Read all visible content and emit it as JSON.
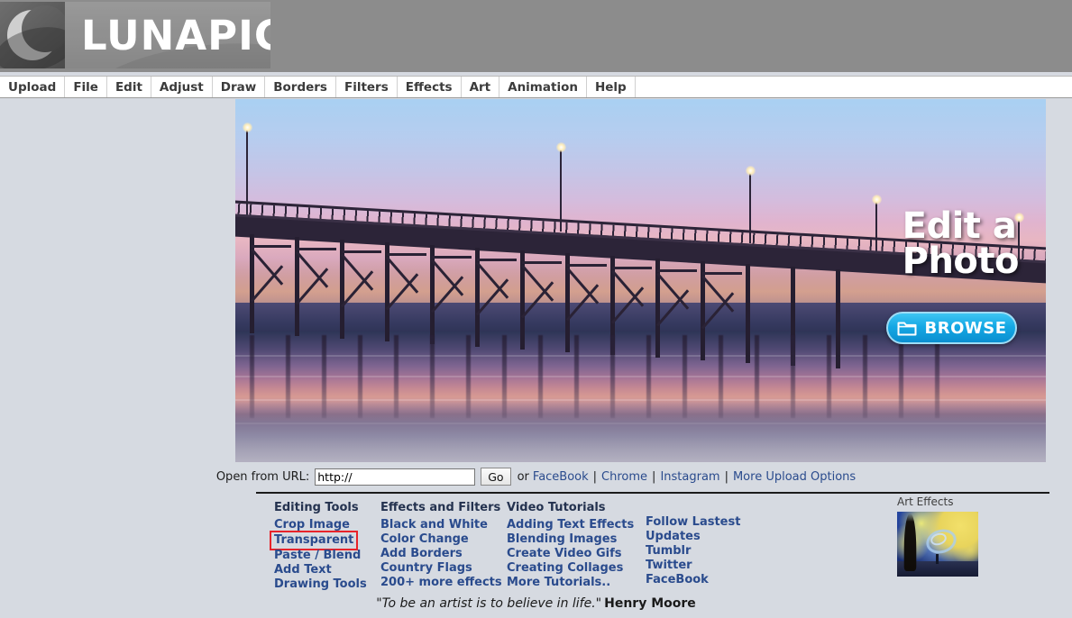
{
  "header": {
    "logo_wordmark": "LUNAPIC",
    "logo_icon": "crescent-moon-icon",
    "bg_color": "#8c8c8c"
  },
  "menubar": {
    "items": [
      {
        "label": "Upload"
      },
      {
        "label": "File"
      },
      {
        "label": "Edit"
      },
      {
        "label": "Adjust"
      },
      {
        "label": "Draw"
      },
      {
        "label": "Borders"
      },
      {
        "label": "Filters"
      },
      {
        "label": "Effects"
      },
      {
        "label": "Art"
      },
      {
        "label": "Animation"
      },
      {
        "label": "Help"
      }
    ]
  },
  "hero": {
    "title_line1": "Edit a",
    "title_line2": "Photo",
    "browse_label": "BROWSE",
    "browse_icon": "folder-icon",
    "image_description": "pier-at-sunset-photo"
  },
  "url_row": {
    "label": "Open from URL:",
    "input_value": "http://",
    "go_label": "Go",
    "or_text": "or",
    "links": [
      {
        "label": "FaceBook"
      },
      {
        "label": "Chrome"
      },
      {
        "label": "Instagram"
      },
      {
        "label": "More Upload Options"
      }
    ],
    "separator": "|"
  },
  "columns": [
    {
      "heading": "Editing Tools",
      "links": [
        {
          "label": "Crop Image",
          "highlighted": false
        },
        {
          "label": "Transparent",
          "highlighted": true
        },
        {
          "label": "Paste / Blend",
          "highlighted": false
        },
        {
          "label": "Add Text",
          "highlighted": false
        },
        {
          "label": "Drawing Tools",
          "highlighted": false
        }
      ]
    },
    {
      "heading": "Effects and Filters",
      "links": [
        {
          "label": "Black and White",
          "highlighted": false
        },
        {
          "label": "Color Change",
          "highlighted": false
        },
        {
          "label": "Add Borders",
          "highlighted": false
        },
        {
          "label": "Country Flags",
          "highlighted": false
        },
        {
          "label": "200+ more effects",
          "highlighted": false
        }
      ]
    },
    {
      "heading": "Video Tutorials",
      "links": [
        {
          "label": "Adding Text Effects",
          "highlighted": false
        },
        {
          "label": "Blending Images",
          "highlighted": false
        },
        {
          "label": "Create Video Gifs",
          "highlighted": false
        },
        {
          "label": "Creating Collages",
          "highlighted": false
        },
        {
          "label": "More Tutorials..",
          "highlighted": false
        }
      ]
    },
    {
      "heading": "",
      "links": [
        {
          "label": "Follow Lastest Updates",
          "highlighted": false
        },
        {
          "label": "Tumblr",
          "highlighted": false
        },
        {
          "label": "Twitter",
          "highlighted": false
        },
        {
          "label": "FaceBook",
          "highlighted": false
        }
      ]
    }
  ],
  "art_effects": {
    "label": "Art Effects",
    "thumbnail": "starry-night-painting-thumbnail"
  },
  "quote": {
    "text": "\"To be an artist is to believe in life.\"",
    "author": "Henry Moore"
  },
  "colors": {
    "page_background": "#d6dae1",
    "header_background": "#8c8c8c",
    "link_blue": "#2a4b8d",
    "highlight_red": "#e8232a",
    "browse_button_blue": "#15a8e4"
  }
}
